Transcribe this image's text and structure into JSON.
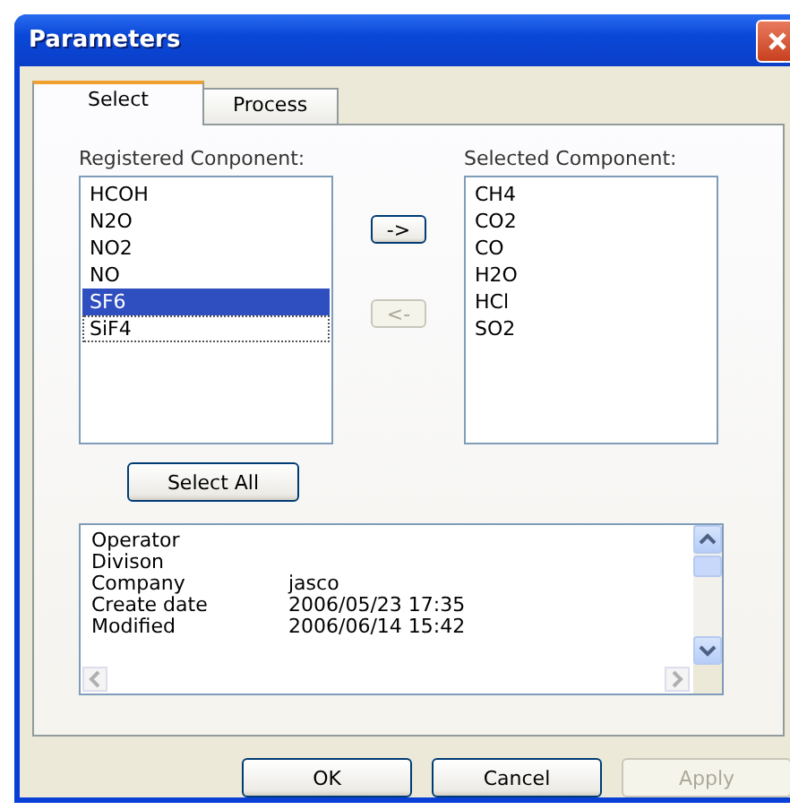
{
  "window": {
    "title": "Parameters"
  },
  "tabs": [
    {
      "label": "Select",
      "selected": true
    },
    {
      "label": "Process",
      "selected": false
    }
  ],
  "registered": {
    "label": "Registered Conponent:",
    "items": [
      {
        "text": "HCOH",
        "selected": false,
        "focused": false
      },
      {
        "text": "N2O",
        "selected": false,
        "focused": false
      },
      {
        "text": "NO2",
        "selected": false,
        "focused": false
      },
      {
        "text": "NO",
        "selected": false,
        "focused": false
      },
      {
        "text": "SF6",
        "selected": true,
        "focused": false
      },
      {
        "text": "SiF4",
        "selected": false,
        "focused": true
      }
    ]
  },
  "move_buttons": [
    {
      "label": "->",
      "disabled": false
    },
    {
      "label": "<-",
      "disabled": true
    }
  ],
  "selected_components": {
    "label": "Selected Component:",
    "items": [
      {
        "text": "CH4",
        "selected": false
      },
      {
        "text": "CO2",
        "selected": false
      },
      {
        "text": "CO",
        "selected": false
      },
      {
        "text": "H2O",
        "selected": false
      },
      {
        "text": "HCl",
        "selected": false
      },
      {
        "text": "SO2",
        "selected": false
      }
    ]
  },
  "select_all": {
    "label": "Select All"
  },
  "info": [
    {
      "label": "Operator"
    },
    {
      "label": "Divison"
    },
    {
      "label": "Company",
      "value": "jasco"
    },
    {
      "label": "Create date",
      "value": "2006/05/23 17:35"
    },
    {
      "label": "Modified",
      "value": "2006/06/14 15:42"
    }
  ],
  "buttons": [
    {
      "label": "OK",
      "disabled": false
    },
    {
      "label": "Cancel",
      "disabled": false
    },
    {
      "label": "Apply",
      "disabled": true
    }
  ]
}
